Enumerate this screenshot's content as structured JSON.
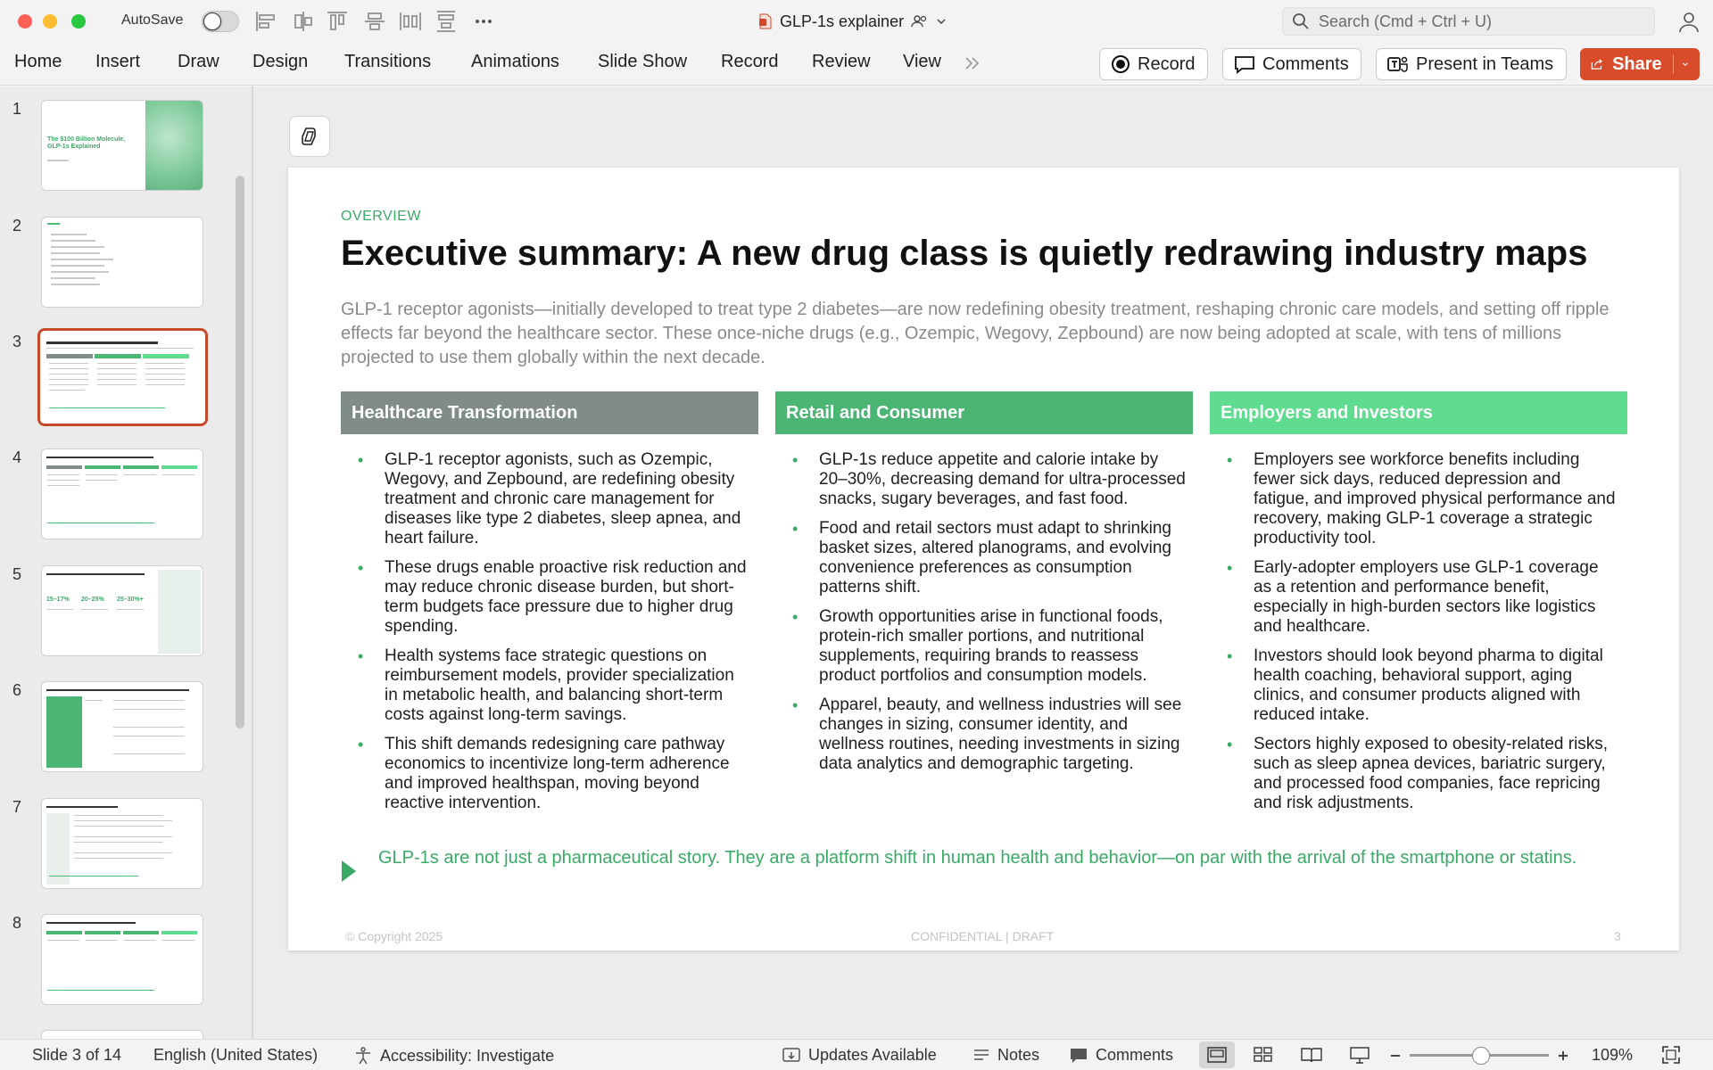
{
  "window": {
    "autosave_label": "AutoSave",
    "autosave_on": false,
    "doc_title": "GLP-1s explainer",
    "search_placeholder": "Search (Cmd + Ctrl + U)"
  },
  "ribbon": {
    "tabs": [
      "Home",
      "Insert",
      "Draw",
      "Design",
      "Transitions",
      "Animations",
      "Slide Show",
      "Record",
      "Review",
      "View"
    ],
    "record_label": "Record",
    "comments_label": "Comments",
    "present_label": "Present in Teams",
    "share_label": "Share",
    "share_color": "#d84b2b"
  },
  "thumbnails": {
    "numbers": [
      "1",
      "2",
      "3",
      "4",
      "5",
      "6",
      "7",
      "8"
    ],
    "active": "3",
    "t1_title": "The $100 Billion Molecule, GLP-1s Explained",
    "t5_stats": [
      "15–17%",
      "20–25%",
      "25–30%+"
    ]
  },
  "slide": {
    "eyebrow": "OVERVIEW",
    "title": "Executive summary: A new drug class is quietly redrawing industry maps",
    "intro": "GLP-1 receptor agonists—initially developed to treat type 2 diabetes—are now redefining obesity treatment, reshaping chronic care models, and setting off ripple effects far beyond the healthcare sector. These once-niche drugs (e.g., Ozempic, Wegovy, Zepbound) are now being adopted at scale, with tens of millions projected to use them globally within the next decade.",
    "columns": [
      {
        "heading": "Healthcare Transformation",
        "color": "#7f8c8a",
        "bullets": [
          "GLP-1 receptor agonists, such as Ozempic, Wegovy, and Zepbound, are redefining obesity treatment and chronic care management for diseases like type 2 diabetes, sleep apnea, and heart failure.",
          "These drugs enable proactive risk reduction and may reduce chronic disease burden, but short-term budgets face pressure due to higher drug spending.",
          "Health systems face strategic questions on reimbursement models, provider specialization in metabolic health, and balancing short-term costs against long-term savings.",
          "This shift demands redesigning care pathway economics to incentivize long-term adherence and improved healthspan, moving beyond reactive intervention."
        ]
      },
      {
        "heading": "Retail and Consumer",
        "color": "#4bb573",
        "bullets": [
          "GLP-1s reduce appetite and calorie intake by 20–30%, decreasing demand for ultra-processed snacks, sugary beverages, and fast food.",
          "Food and retail sectors must adapt to shrinking basket sizes, altered planograms, and evolving convenience preferences as consumption patterns shift.",
          "Growth opportunities arise in functional foods, protein-rich smaller portions, and nutritional supplements, requiring brands to reassess product portfolios and consumption models.",
          "Apparel, beauty, and wellness industries will see changes in sizing, consumer identity, and wellness routines, needing investments in sizing data analytics and demographic targeting."
        ]
      },
      {
        "heading": "Employers and Investors",
        "color": "#5fdc8f",
        "bullets": [
          "Employers see workforce benefits including fewer sick days, reduced depression and fatigue, and improved physical performance and recovery, making GLP-1 coverage a strategic productivity tool.",
          "Early-adopter employers use GLP-1 coverage as a retention and performance benefit, especially in high-burden sectors like logistics and healthcare.",
          "Investors should look beyond pharma to digital health coaching, behavioral support, aging clinics, and consumer products aligned with reduced intake.",
          "Sectors highly exposed to obesity-related risks, such as sleep apnea devices, bariatric surgery, and processed food companies, face repricing and risk adjustments."
        ]
      }
    ],
    "callout": "GLP-1s are not just a pharmaceutical story. They are a platform shift in human health and behavior—on par with the arrival of the smartphone or statins.",
    "footer_left": "© Copyright 2025",
    "footer_center": "CONFIDENTIAL | DRAFT",
    "footer_right": "3",
    "accent_color": "#3aaa67"
  },
  "statusbar": {
    "slide_info": "Slide 3 of 14",
    "language": "English (United States)",
    "accessibility": "Accessibility: Investigate",
    "updates": "Updates Available",
    "notes": "Notes",
    "comments": "Comments",
    "zoom": "109%"
  }
}
